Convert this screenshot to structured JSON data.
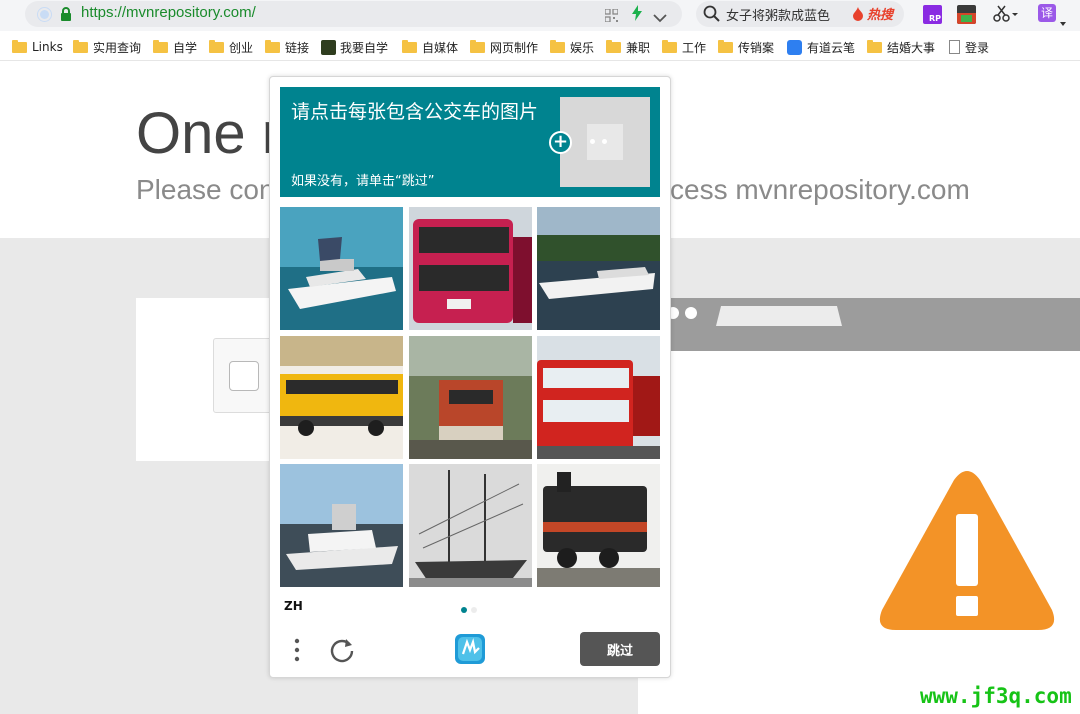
{
  "browser": {
    "url": "https://mvnrepository.com/",
    "search_text": "女子将粥款成蓝色",
    "hot_label": "热搜",
    "translate_label": "译",
    "ext_label": "RP"
  },
  "bookmarks": [
    {
      "label": "Links"
    },
    {
      "label": "实用查询"
    },
    {
      "label": "自学"
    },
    {
      "label": "创业"
    },
    {
      "label": "链接"
    },
    {
      "label": "我要自学"
    },
    {
      "label": "自媒体"
    },
    {
      "label": "网页制作"
    },
    {
      "label": "娱乐"
    },
    {
      "label": "兼职"
    },
    {
      "label": "工作"
    },
    {
      "label": "传销案"
    },
    {
      "label": "有道云笔"
    },
    {
      "label": "结婚大事"
    },
    {
      "label": "登录"
    }
  ],
  "page": {
    "title": "One m",
    "subtitle_left": "Please con",
    "subtitle_right": "cess mvnrepository.com"
  },
  "captcha": {
    "prompt": "请点击每张包含公交车的图片",
    "prompt_sub": "如果没有，请单击“跳过”",
    "language": "ZH",
    "skip_label": "跳过",
    "tiles": [
      {
        "subject": "yacht"
      },
      {
        "subject": "double-decker bus"
      },
      {
        "subject": "motorboat"
      },
      {
        "subject": "school bus"
      },
      {
        "subject": "train locomotive"
      },
      {
        "subject": "red double-decker bus"
      },
      {
        "subject": "yacht"
      },
      {
        "subject": "sailing ship"
      },
      {
        "subject": "steam locomotive"
      }
    ],
    "accent_color": "#00838f"
  },
  "watermark": "www.jf3q.com"
}
